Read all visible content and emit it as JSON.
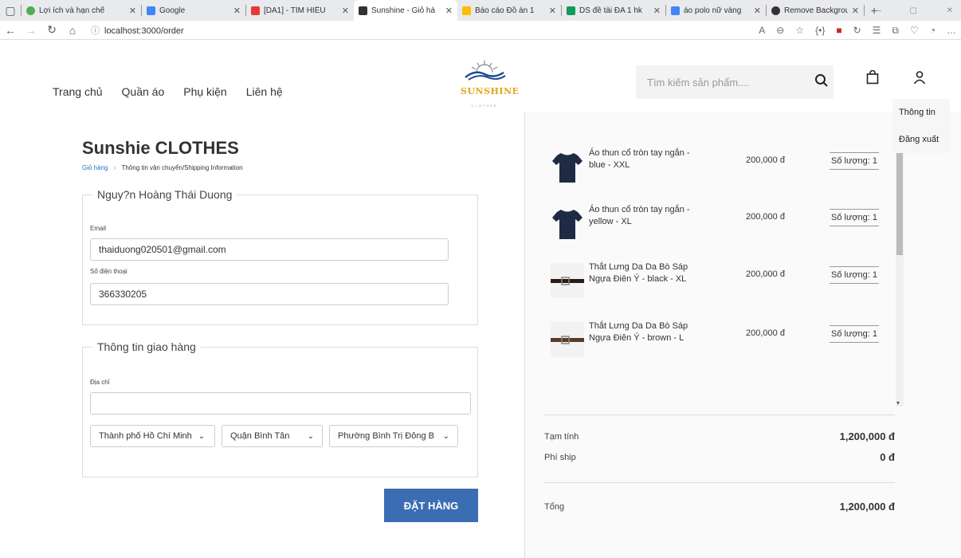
{
  "browser": {
    "tabs": [
      {
        "title": "Lợi ích và hạn chế",
        "color": "#4caf50"
      },
      {
        "title": "Google",
        "color": "#4285f4"
      },
      {
        "title": "[DA1] - TÌM HIỂU",
        "color": "#e53935"
      },
      {
        "title": "Sunshine - Giỏ hà",
        "color": "#333333"
      },
      {
        "title": "Báo cáo Đồ án 1",
        "color": "#fbbc04"
      },
      {
        "title": "DS đề tài ĐA 1 hk",
        "color": "#0f9d58"
      },
      {
        "title": "áo polo nữ vàng",
        "color": "#4285f4"
      },
      {
        "title": "Remove Backgrou",
        "color": "#333333"
      }
    ],
    "url": "localhost:3000/order"
  },
  "header": {
    "nav": [
      "Trang chủ",
      "Quần áo",
      "Phụ kiện",
      "Liên hệ"
    ],
    "logo_text": "SUNSHINE",
    "logo_sub": "CLOTHES",
    "search_placeholder": "Tìm kiếm sản phẩm...."
  },
  "user_menu": [
    "Thông tin",
    "Đăng xuất"
  ],
  "checkout": {
    "title": "Sunshie CLOTHES",
    "breadcrumb": {
      "cart": "Giỏ hàng",
      "sep": "›",
      "current": "Thông tin vận chuyển/Shipping Information"
    },
    "customer": {
      "name": "Nguy?n Hoàng Thái Duong",
      "email_label": "Email",
      "email": "thaiduong020501@gmail.com",
      "phone_label": "Số điện thoại",
      "phone": "366330205"
    },
    "shipping": {
      "legend": "Thông tin giao hàng",
      "address_label": "Địa chỉ",
      "address": "",
      "city": "Thành phố Hồ Chí Minh",
      "district": "Quận Bình Tân",
      "ward": "Phường Bình Trị Đông B"
    },
    "order_button": "ĐẶT HÀNG"
  },
  "cart": {
    "items": [
      {
        "name": "Áo thun cổ tròn tay ngắn - blue - XXL",
        "price": "200,000 đ",
        "qty": "Số lượng: 1",
        "kind": "shirt"
      },
      {
        "name": "Áo thun cổ tròn tay ngắn - yellow - XL",
        "price": "200,000 đ",
        "qty": "Số lượng: 1",
        "kind": "shirt"
      },
      {
        "name": "Thắt Lưng Da Da Bò Sáp Ngựa Điên Ý - black - XL",
        "price": "200,000 đ",
        "qty": "Số lượng: 1",
        "kind": "belt"
      },
      {
        "name": "Thắt Lưng Da Da Bò Sáp Ngựa Điên Ý - brown - L",
        "price": "200,000 đ",
        "qty": "Số lượng: 1",
        "kind": "belt"
      }
    ],
    "subtotal_label": "Tạm tính",
    "subtotal": "1,200,000 đ",
    "shipping_label": "Phí ship",
    "shipping": "0 đ",
    "total_label": "Tổng",
    "total": "1,200,000 đ"
  }
}
